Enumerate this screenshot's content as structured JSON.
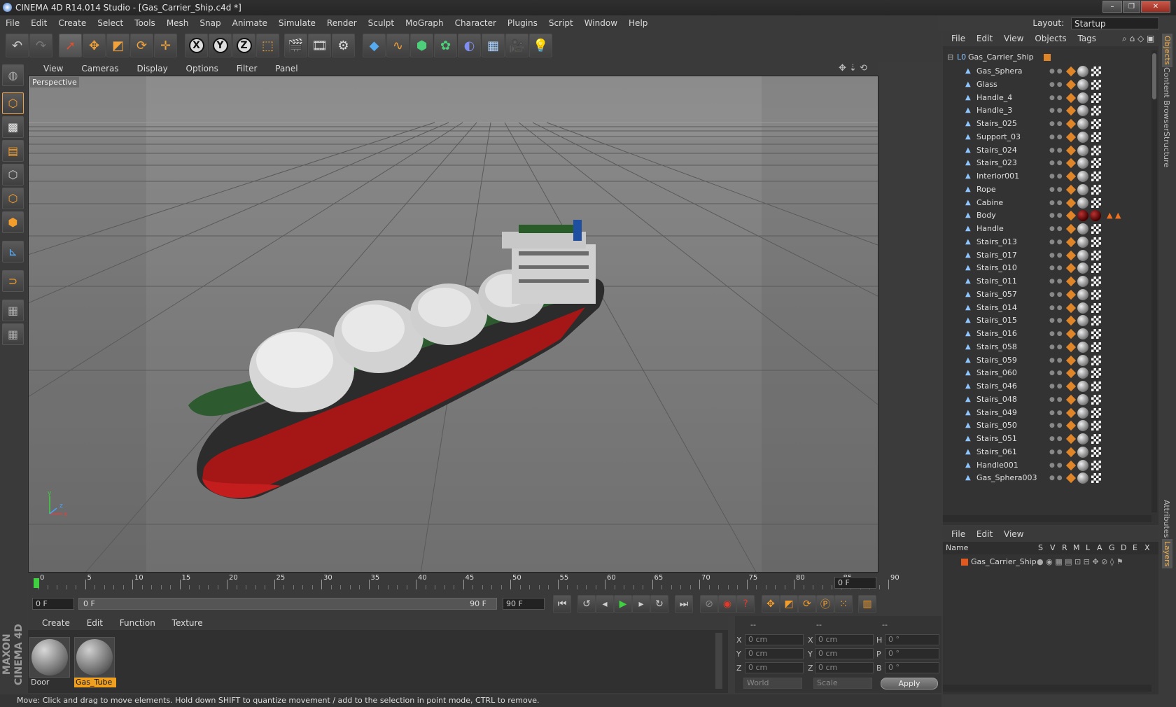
{
  "app": {
    "title": "CINEMA 4D R14.014 Studio - [Gas_Carrier_Ship.c4d *]",
    "layout_label": "Layout:",
    "layout_value": "Startup"
  },
  "menu": [
    "File",
    "Edit",
    "Create",
    "Select",
    "Tools",
    "Mesh",
    "Snap",
    "Animate",
    "Simulate",
    "Render",
    "Sculpt",
    "MoGraph",
    "Character",
    "Plugins",
    "Script",
    "Window",
    "Help"
  ],
  "viewport": {
    "menu": [
      "View",
      "Cameras",
      "Display",
      "Options",
      "Filter",
      "Panel"
    ],
    "label": "Perspective"
  },
  "timeline": {
    "ticks": [
      "0",
      "5",
      "10",
      "15",
      "20",
      "25",
      "30",
      "35",
      "40",
      "45",
      "50",
      "55",
      "60",
      "65",
      "70",
      "75",
      "80",
      "85",
      "90"
    ],
    "current_frame": "0 F",
    "start_field": "0 F",
    "range_start": "0 F",
    "range_end": "90 F",
    "end_field": "90 F"
  },
  "material_manager": {
    "menu": [
      "Create",
      "Edit",
      "Function",
      "Texture"
    ],
    "materials": [
      {
        "name": "Door",
        "selected": false
      },
      {
        "name": "Gas_Tube",
        "selected": true
      }
    ]
  },
  "coordinates": {
    "header": [
      "--",
      "--",
      "--"
    ],
    "rows": [
      {
        "a": "X",
        "a_val": "0 cm",
        "b": "X",
        "b_val": "0 cm",
        "c": "H",
        "c_val": "0 °"
      },
      {
        "a": "Y",
        "a_val": "0 cm",
        "b": "Y",
        "b_val": "0 cm",
        "c": "P",
        "c_val": "0 °"
      },
      {
        "a": "Z",
        "a_val": "0 cm",
        "b": "Z",
        "b_val": "0 cm",
        "c": "B",
        "c_val": "0 °"
      }
    ],
    "mode": "World",
    "transform": "Scale",
    "apply": "Apply"
  },
  "status": "Move: Click and drag to move elements. Hold down SHIFT to quantize movement / add to the selection in point mode, CTRL to remove.",
  "objects": {
    "menu": [
      "File",
      "Edit",
      "View",
      "Objects",
      "Tags"
    ],
    "root": "Gas_Carrier_Ship",
    "items": [
      "Gas_Sphera",
      "Glass",
      "Handle_4",
      "Handle_3",
      "Stairs_025",
      "Support_03",
      "Stairs_024",
      "Stairs_023",
      "Interior001",
      "Rope",
      "Cabine",
      "Body",
      "Handle",
      "Stairs_013",
      "Stairs_017",
      "Stairs_010",
      "Stairs_011",
      "Stairs_057",
      "Stairs_014",
      "Stairs_015",
      "Stairs_016",
      "Stairs_058",
      "Stairs_059",
      "Stairs_060",
      "Stairs_046",
      "Stairs_048",
      "Stairs_049",
      "Stairs_050",
      "Stairs_051",
      "Stairs_061",
      "Handle001",
      "Gas_Sphera003"
    ]
  },
  "layers": {
    "menu": [
      "File",
      "Edit",
      "View"
    ],
    "columns": [
      "Name",
      "S",
      "V",
      "R",
      "M",
      "L",
      "A",
      "G",
      "D",
      "E",
      "X"
    ],
    "row": "Gas_Carrier_Ship"
  },
  "side_tabs": [
    "Objects",
    "Content Browser",
    "Structure",
    "Attributes",
    "Layers"
  ],
  "brand": [
    "MAXON",
    "CINEMA 4D"
  ]
}
